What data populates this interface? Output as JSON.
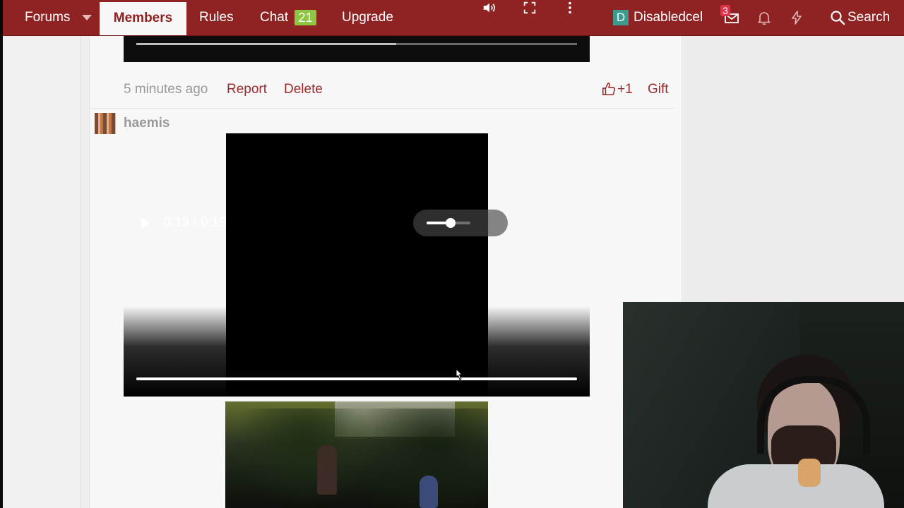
{
  "navbar": {
    "forums": "Forums",
    "members": "Members",
    "rules": "Rules",
    "chat": "Chat",
    "chat_count": "21",
    "upgrade": "Upgrade",
    "avatar_letter": "D",
    "username": "Disabledcel",
    "inbox_count": "3",
    "search": "Search",
    "colors": {
      "bar": "#8f2222",
      "chat_badge": "#8dc63f",
      "avatar": "#3a9b8f"
    }
  },
  "previous_post": {
    "video_progress_fraction": 0.59,
    "timestamp": "5 minutes ago",
    "report": "Report",
    "delete": "Delete",
    "like": "+1",
    "gift": "Gift"
  },
  "post": {
    "username": "haemis",
    "video": {
      "time": "0:19 / 0:19",
      "progress_fraction": 1.0,
      "volume_fraction": 0.55
    }
  },
  "icons": {
    "forums_dropdown": "caret-down-icon",
    "inbox": "envelope-icon",
    "notifications": "bell-icon",
    "whats_new": "bolt-icon",
    "search": "magnifier-icon",
    "like": "thumbs-up-icon",
    "play": "play-icon",
    "volume": "speaker-icon",
    "fullscreen": "fullscreen-icon",
    "more": "kebab-icon"
  }
}
